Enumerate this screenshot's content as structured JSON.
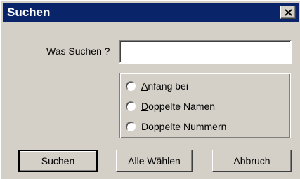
{
  "window": {
    "title": "Suchen",
    "close_icon": "close-icon"
  },
  "search": {
    "label": "Was Suchen ?",
    "value": "",
    "placeholder": ""
  },
  "options": [
    {
      "mnemonic": "A",
      "rest": "nfang bei",
      "prefix": "",
      "selected": false
    },
    {
      "mnemonic": "D",
      "rest": "oppelte Namen",
      "prefix": "",
      "selected": false
    },
    {
      "mnemonic": "N",
      "rest": "ummern",
      "prefix": "Doppelte ",
      "selected": false
    }
  ],
  "buttons": {
    "search": "Suchen",
    "select_all": "Alle Wählen",
    "cancel": "Abbruch"
  }
}
